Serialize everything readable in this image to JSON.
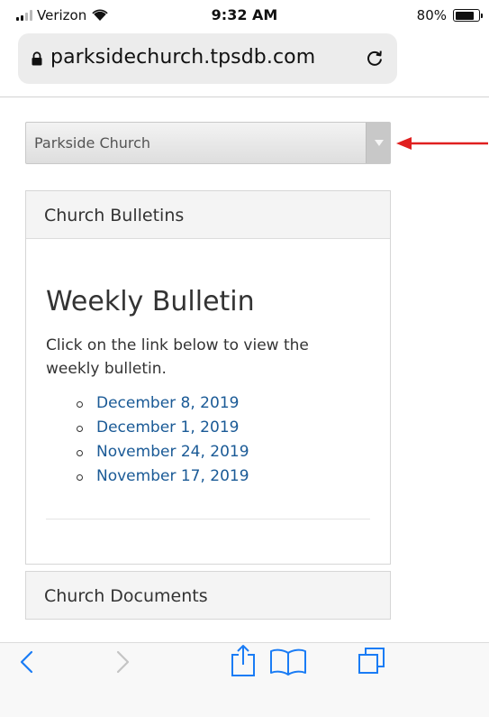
{
  "status_bar": {
    "carrier": "Verizon",
    "time": "9:32 AM",
    "battery_percent": "80%",
    "battery_level": 0.8,
    "signal_bars": 2
  },
  "browser": {
    "url": "parksidechurch.tpsdb.com",
    "icons": {
      "lock": "lock-icon",
      "reload": "reload-icon",
      "back": "back-chevron-icon",
      "forward": "forward-chevron-icon",
      "share": "share-icon",
      "bookmarks": "book-icon",
      "tabs": "tabs-icon"
    }
  },
  "site_select": {
    "selected": "Parkside Church"
  },
  "bulletins_panel": {
    "heading": "Church Bulletins",
    "title": "Weekly Bulletin",
    "intro": "Click on the link below to view the weekly bulletin.",
    "links": [
      "December 8, 2019",
      "December 1, 2019",
      "November 24, 2019",
      "November 17, 2019"
    ]
  },
  "documents_panel": {
    "heading": "Church Documents"
  },
  "colors": {
    "link": "#1a5a96",
    "ios_blue": "#1a7cf5",
    "annotation_arrow": "#e02020"
  }
}
